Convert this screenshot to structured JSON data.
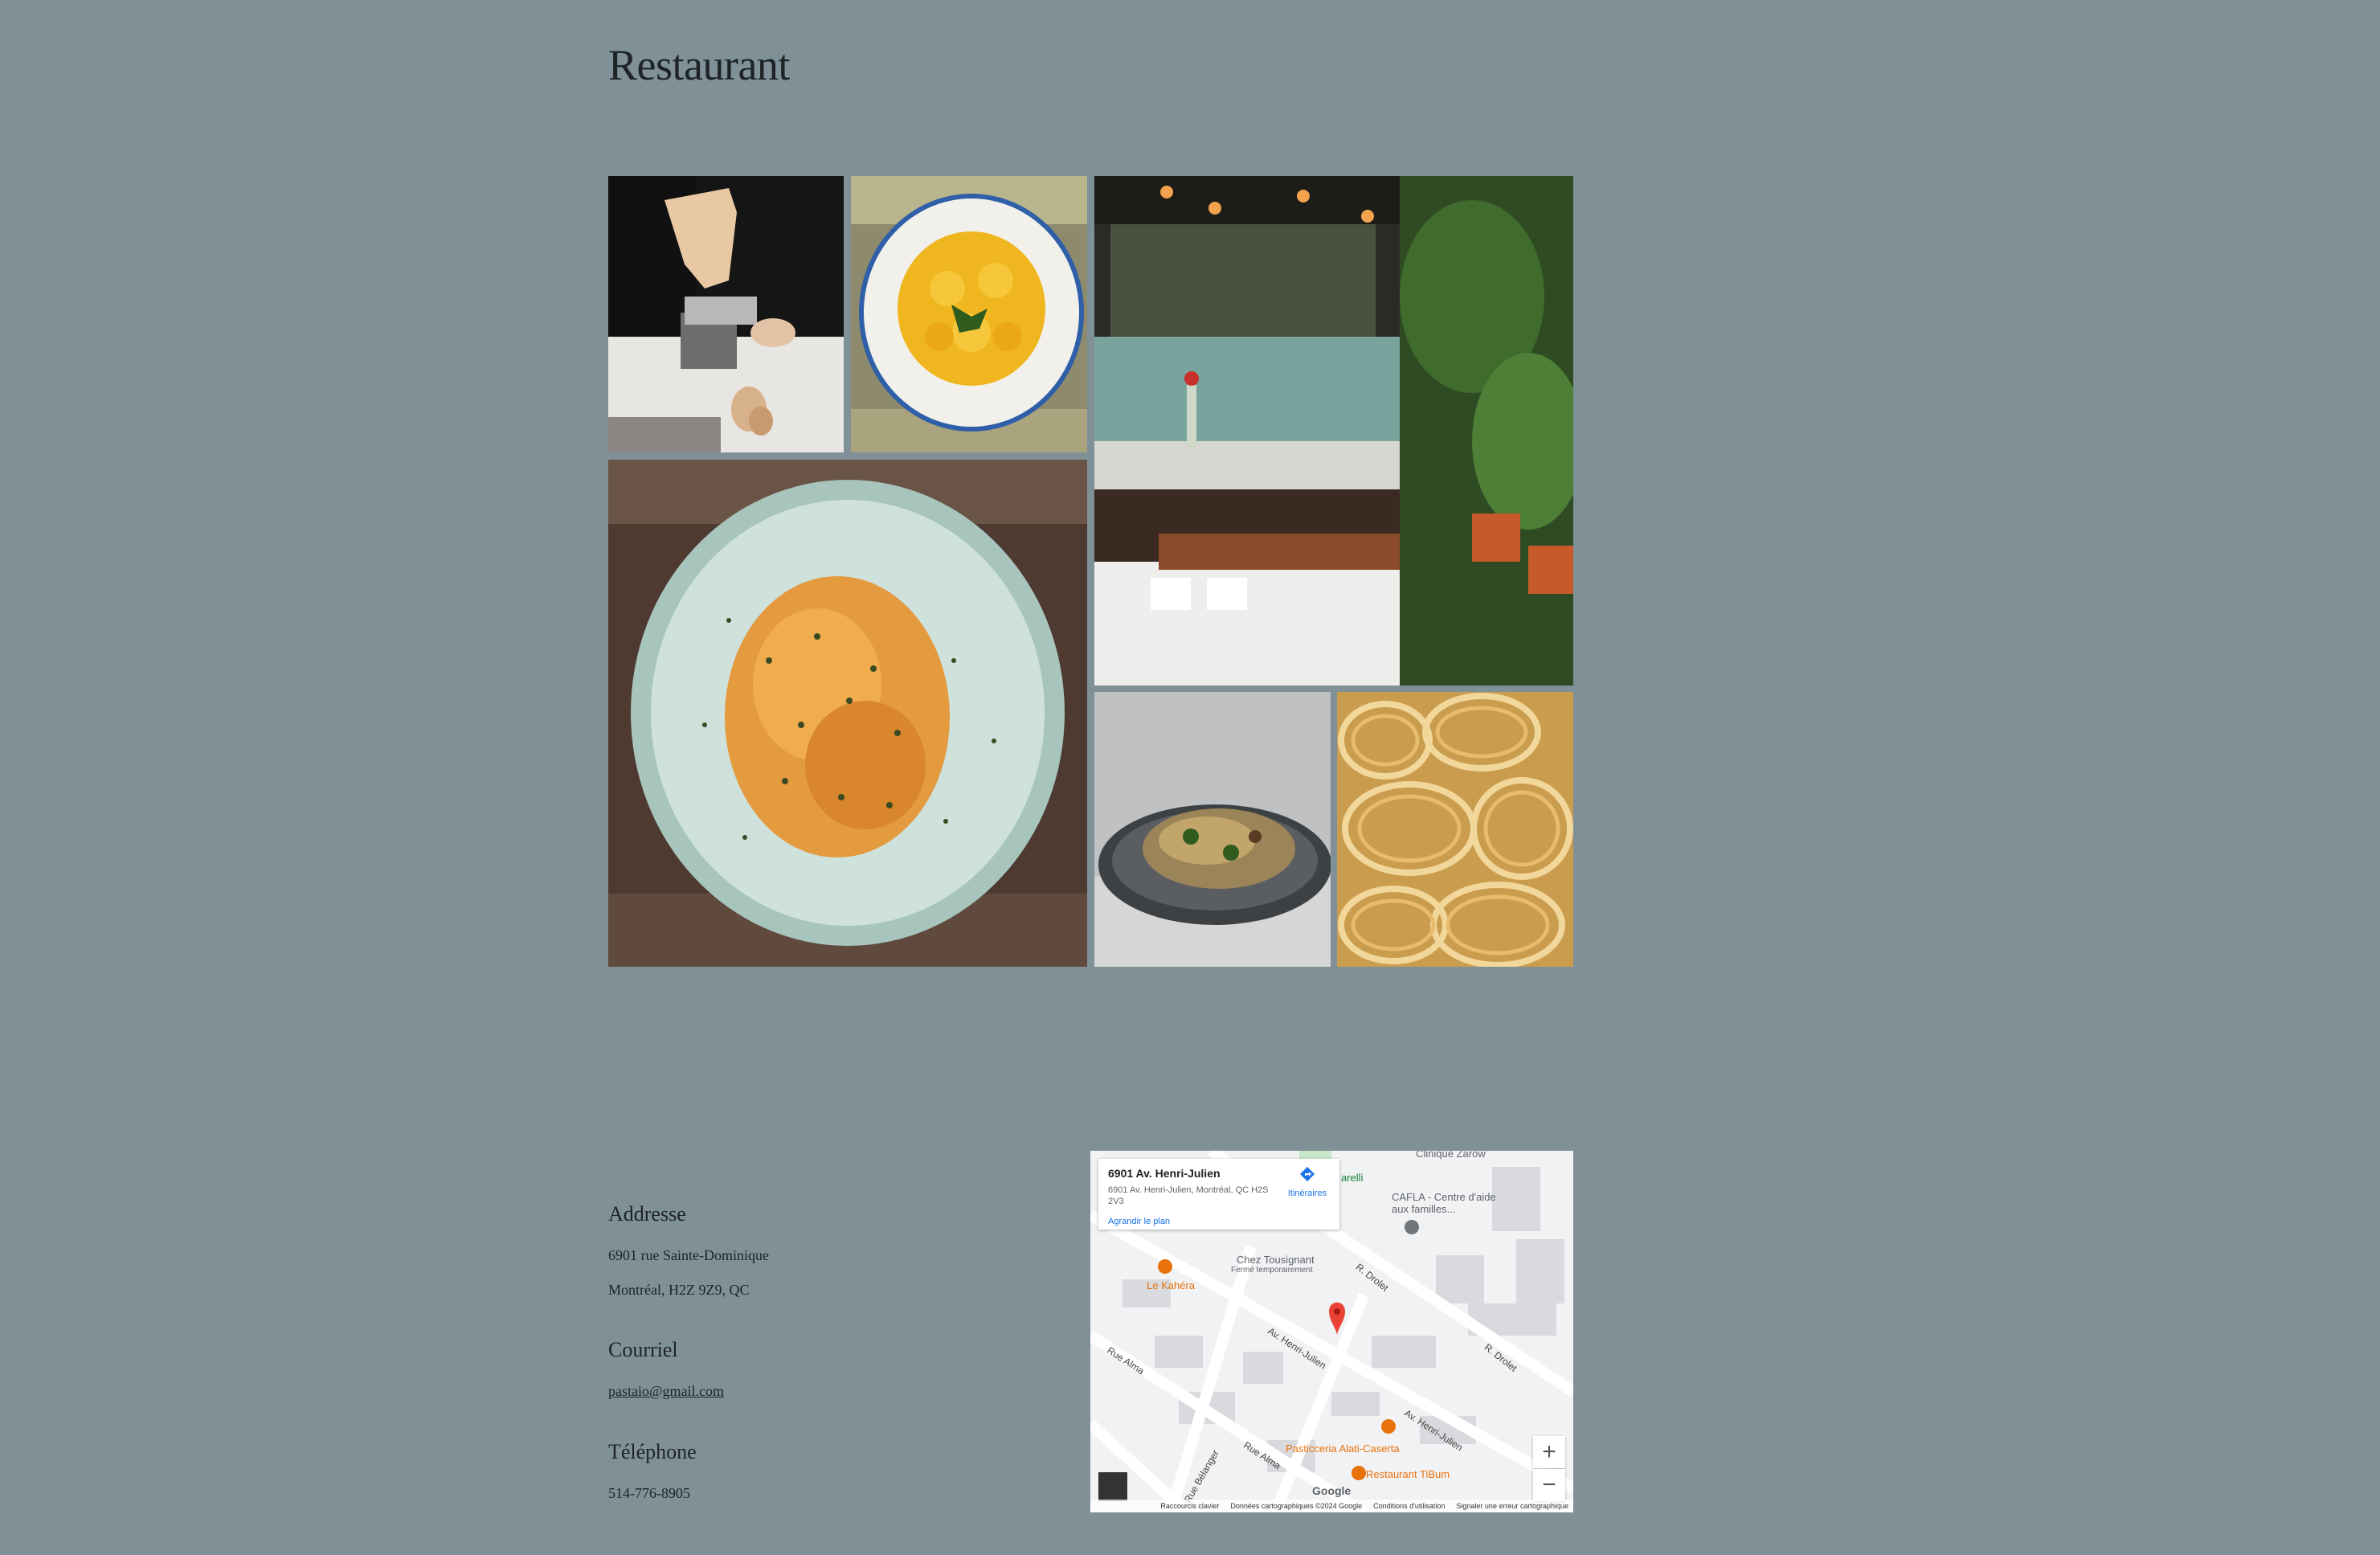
{
  "page": {
    "title": "Restaurant"
  },
  "gallery": {
    "images": [
      {
        "name": "pasta-making-photo"
      },
      {
        "name": "ravioli-plate-photo"
      },
      {
        "name": "restaurant-interior-photo"
      },
      {
        "name": "penne-dish-photo"
      },
      {
        "name": "spaghetti-plate-photo"
      },
      {
        "name": "fresh-tagliatelle-photo"
      }
    ]
  },
  "contact": {
    "address_heading": "Addresse",
    "address_line1": "6901 rue Sainte-Dominique",
    "address_line2": "Montréal, H2Z 9Z9, QC",
    "email_heading": "Courriel",
    "email": "pastaio@gmail.com",
    "phone_heading": "Téléphone",
    "phone": "514-776-8905"
  },
  "map": {
    "place_title": "6901 Av. Henri-Julien",
    "place_address": "6901 Av. Henri-Julien, Montréal, QC H2S 2V3",
    "directions_label": "Itinéraires",
    "enlarge_label": "Agrandir le plan",
    "zoom_in": "+",
    "zoom_out": "−",
    "pois": {
      "clinique": "Clinique Zarow",
      "arelli": "arelli",
      "cafla": "CAFLA - Centre d'aide aux familles...",
      "chez_tousignant": "Chez Tousignant",
      "chez_tousignant_status": "Fermé temporairement",
      "le_kahera": "Le Kahéra",
      "pasticceria": "Pasticceria Alati-Caserta",
      "tibum": "Restaurant TiBum"
    },
    "streets": {
      "r_drolet_1": "R. Drolet",
      "r_drolet_2": "R. Drolet",
      "henri_julien_1": "Av. Henri-Julien",
      "henri_julien_2": "Av. Henri-Julien",
      "rue_alma_1": "Rue Alma",
      "rue_alma_2": "Rue Alma",
      "rue_belanger": "Rue Bélanger"
    },
    "attribution": {
      "logo": "Google",
      "shortcuts": "Raccourcis clavier",
      "data": "Données cartographiques ©2024 Google",
      "terms": "Conditions d'utilisation",
      "report": "Signaler une erreur cartographique"
    },
    "colors": {
      "pin": "#ea4335",
      "link": "#1a73e8",
      "poi_orange": "#e8710a"
    }
  }
}
